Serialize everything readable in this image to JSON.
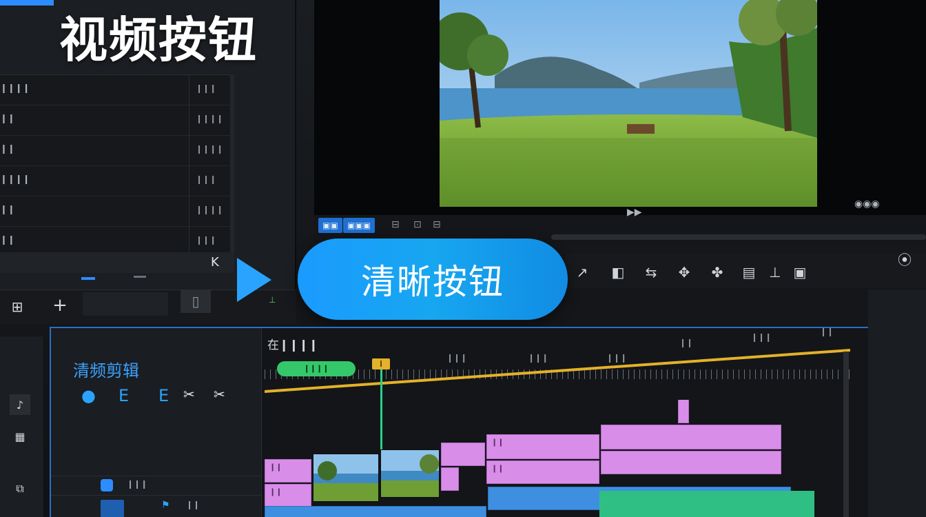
{
  "title": "视频按钮",
  "callout_label": "清晰按钮",
  "left_panel": {
    "rows": [
      {
        "name": "❙❙❙❙",
        "value": "❙❙❙"
      },
      {
        "name": "❙❙",
        "value": "❙❙❙❙"
      },
      {
        "name": "❙❙",
        "value": "❙❙❙❙"
      },
      {
        "name": "❙❙❙❙",
        "value": "❙❙❙"
      },
      {
        "name": "❙❙",
        "value": "❙❙❙❙"
      },
      {
        "name": "❙❙",
        "value": "❙❙❙"
      }
    ],
    "footer_icon": "K",
    "add_icon": "+",
    "grid_icon": "⊞",
    "file_icon": "▯"
  },
  "viewer": {
    "chips": [
      "▣▣",
      "▣▣▣"
    ],
    "glyphs": [
      "⊟",
      "⊡",
      "⊟",
      "▶▶",
      "◉◉◉"
    ]
  },
  "toolbar_icons": [
    "↗",
    "◧",
    "⇆",
    "✥",
    "✤",
    "▤",
    "⊥",
    "▣",
    "⦿"
  ],
  "timeline": {
    "panel_title": "清频剪辑",
    "header_text": "在❙❙❙❙",
    "green_tag": "❙❙❙❙",
    "yellow_tag": "❙",
    "ruler_labels": [
      "❙❙❙",
      "❙❙❙",
      "❙❙❙",
      "❙❙",
      "❙❙❙",
      "❙❙"
    ],
    "side_icons": [
      "●",
      "E",
      "E",
      "✂",
      "✂"
    ],
    "track1_label": "❙❙❙",
    "track2_label": "❙❙",
    "clip_labels": [
      "❙❙",
      "❙❙",
      "❙❙",
      "❙❙"
    ]
  },
  "colors": {
    "accent": "#2aa3ff",
    "pill": "#1a9bff",
    "timeline_border": "#2d6fc4",
    "playhead": "#29d08a",
    "marker": "#e4b12a",
    "clip_pink": "#d88ee8",
    "clip_blue": "#3e8fe0",
    "clip_green": "#2fbf84"
  }
}
